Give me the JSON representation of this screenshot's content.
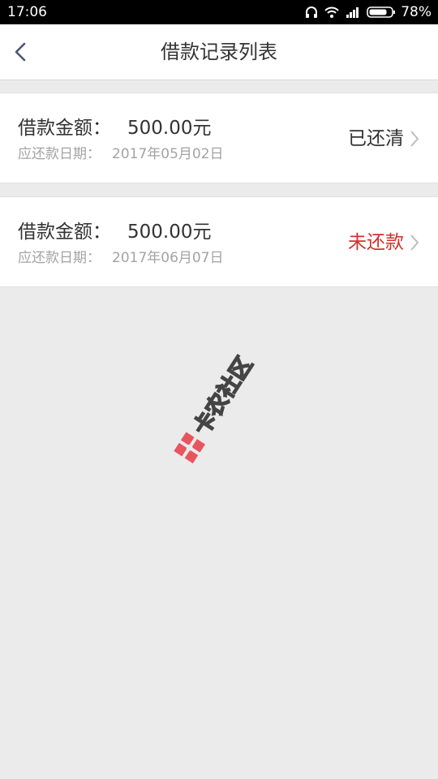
{
  "status_bar": {
    "time": "17:06",
    "battery": "78%",
    "icons": [
      "headphones-icon",
      "wifi-icon",
      "signal-icon",
      "battery-icon"
    ]
  },
  "nav": {
    "title": "借款记录列表",
    "back_icon": "back-chevron-icon"
  },
  "records": [
    {
      "amount_label": "借款金额：",
      "amount": "500.00元",
      "date_label": "应还款日期：",
      "date": "2017年05月02日",
      "status": "已还清",
      "status_color": "#333333"
    },
    {
      "amount_label": "借款金额：",
      "amount": "500.00元",
      "date_label": "应还款日期：",
      "date": "2017年06月07日",
      "status": "未还款",
      "status_color": "#d0312d"
    }
  ],
  "watermark": {
    "text": "卡农社区",
    "color": "#e8555f"
  }
}
